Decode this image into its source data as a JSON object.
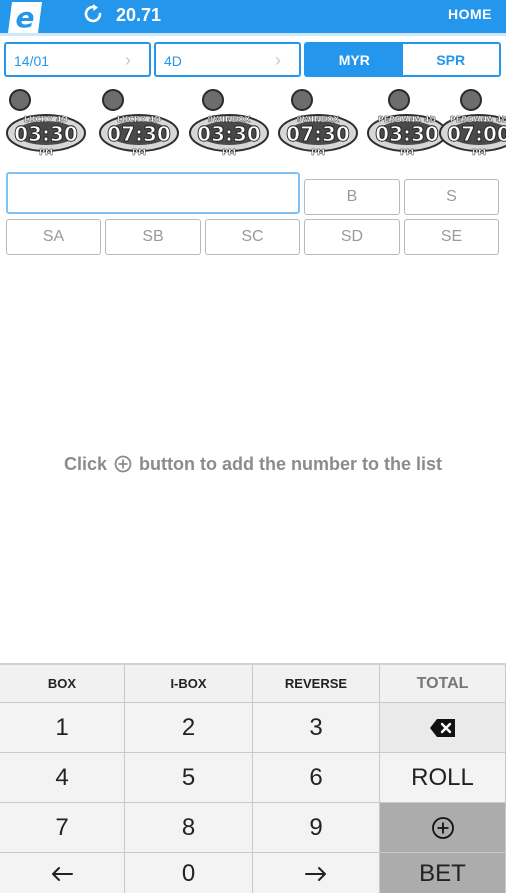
{
  "header": {
    "logo_letter": "e",
    "balance": "20.71",
    "home_label": "HOME"
  },
  "selectors": {
    "date": "14/01",
    "game_type": "4D",
    "currency_options": [
      "MYR",
      "SPR"
    ],
    "selected_currency": "MYR"
  },
  "draws": [
    {
      "brand": "LUCKY 4D",
      "time": "03:30",
      "period": "PM",
      "logo": "lucky-logo"
    },
    {
      "brand": "LUCKY 4D",
      "time": "07:30",
      "period": "PM",
      "logo": "lucky-logo"
    },
    {
      "brand": "9WINBOX",
      "time": "03:30",
      "period": "PM",
      "logo": "9winbox-logo"
    },
    {
      "brand": "9WINBOX",
      "time": "07:30",
      "period": "PM",
      "logo": "9winbox-logo"
    },
    {
      "brand": "PERDANA 4D",
      "time": "03:30",
      "period": "PM",
      "logo": "perdana-logo"
    },
    {
      "brand": "PERDANA 4D",
      "time": "07:00",
      "period": "PM",
      "logo": "perdana-logo"
    }
  ],
  "bet_options": {
    "row1": [
      "B",
      "S"
    ],
    "row2": [
      "SA",
      "SB",
      "SC",
      "SD",
      "SE"
    ]
  },
  "hint": {
    "before": "Click",
    "after": "button to add the number to the list"
  },
  "keypad": {
    "header": [
      "BOX",
      "I-BOX",
      "REVERSE",
      "TOTAL"
    ],
    "rows": [
      [
        "1",
        "2",
        "3"
      ],
      [
        "4",
        "5",
        "6"
      ],
      [
        "7",
        "8",
        "9"
      ],
      [
        "",
        "0",
        ""
      ]
    ],
    "side": {
      "roll": "ROLL",
      "bet": "BET"
    }
  }
}
